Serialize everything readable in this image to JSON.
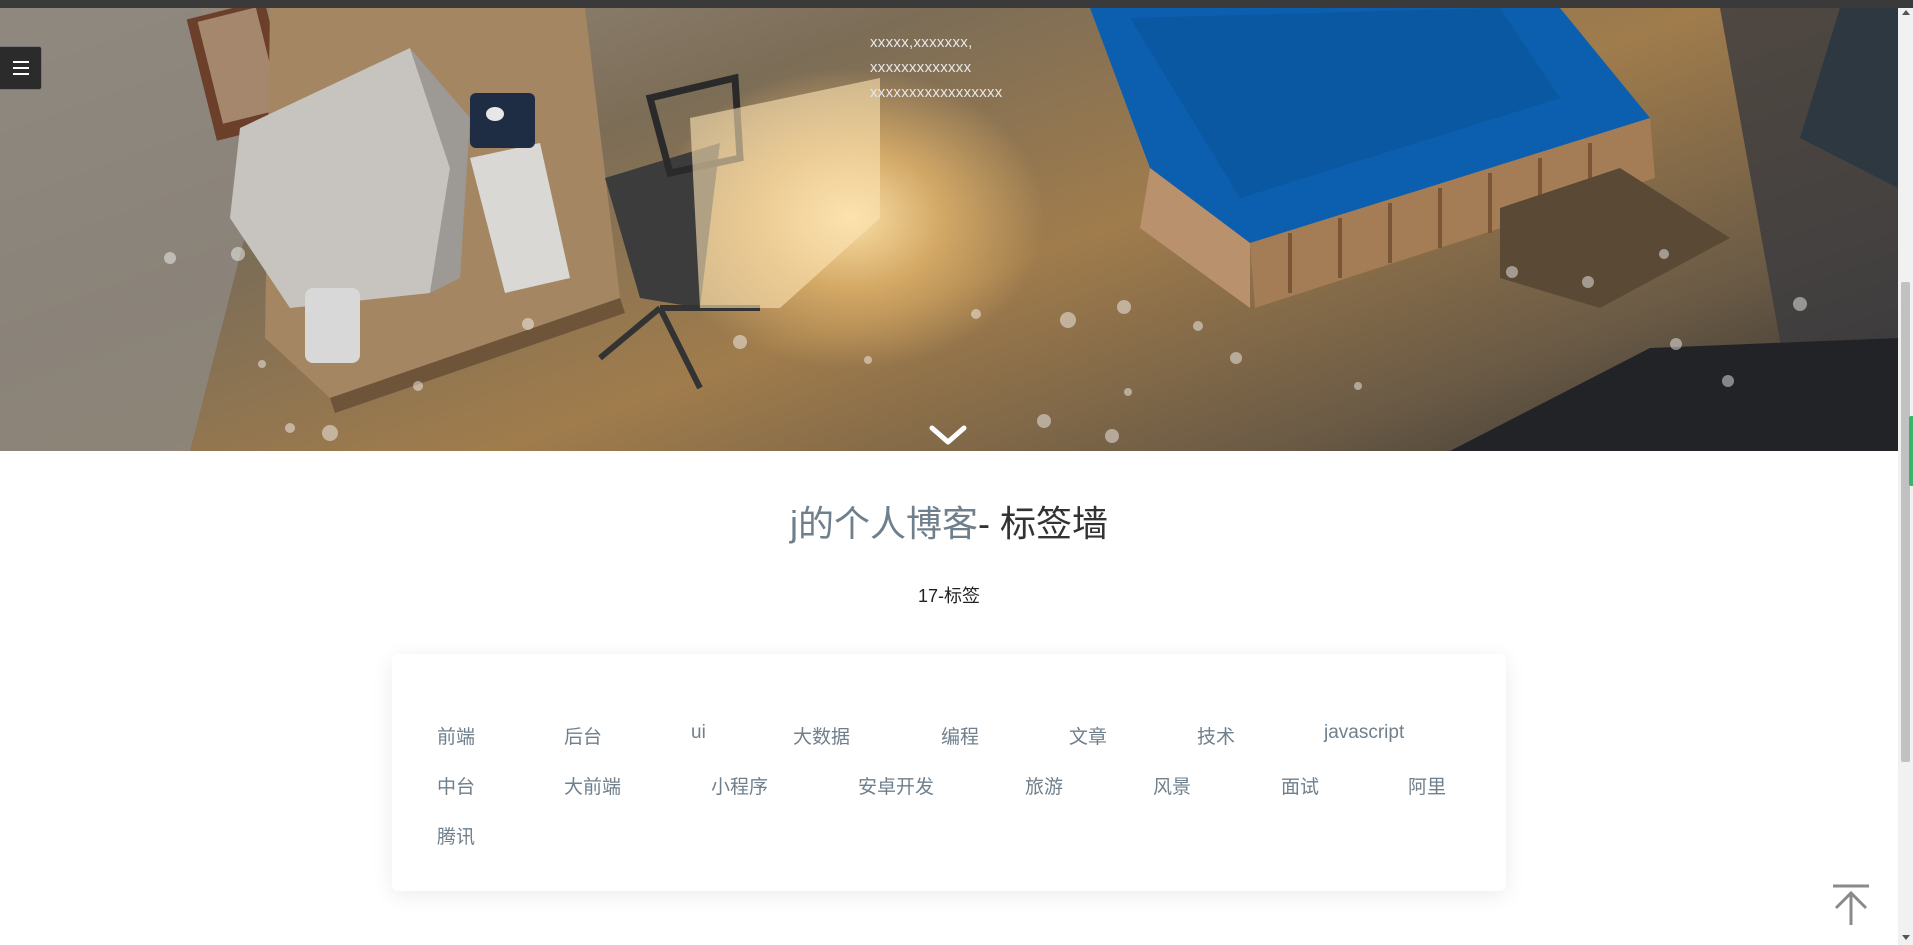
{
  "hero": {
    "lines": [
      "xxxxx,xxxxxxx,",
      "xxxxxxxxxxxxx",
      "xxxxxxxxxxxxxxxxx"
    ]
  },
  "page": {
    "title_blog": "j的个人博客",
    "title_rest": "- 标签墙",
    "subtitle": "17-标签"
  },
  "tags": [
    "前端",
    "后台",
    "ui",
    "大数据",
    "编程",
    "文章",
    "技术",
    "javascript",
    "中台",
    "大前端",
    "小程序",
    "安卓开发",
    "旅游",
    "风景",
    "面试",
    "阿里",
    "腾讯"
  ],
  "icons": {
    "menu": "menu-icon",
    "scroll_down": "chevron-down-icon",
    "back_to_top": "arrow-up-icon"
  },
  "colors": {
    "tag": "#6f7f8c",
    "title_accent": "#6f7f8c",
    "bed_blue": "#0b5fae"
  }
}
